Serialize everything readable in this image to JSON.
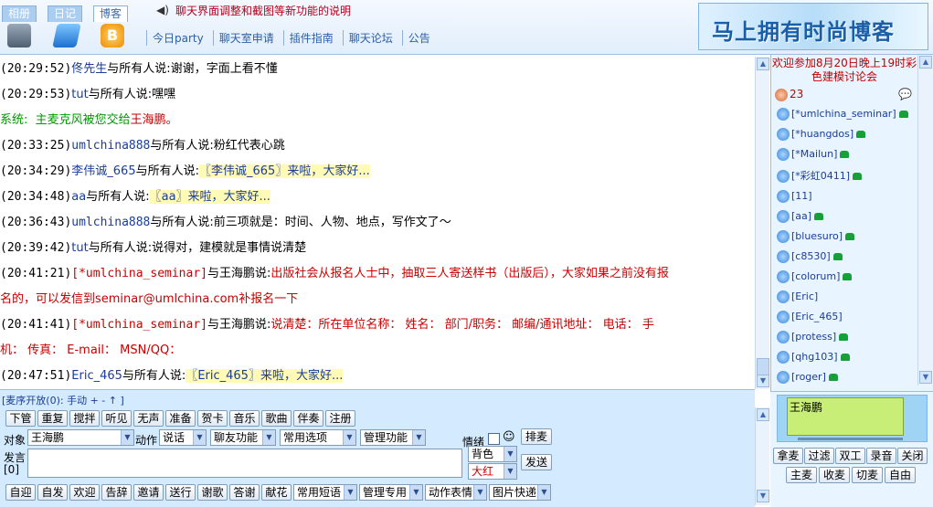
{
  "header": {
    "tabs": [
      "相册",
      "日记",
      "博客"
    ],
    "active_tab": "博客",
    "announcement": "聊天界面调整和截图等新功能的说明",
    "nav": [
      "今日party",
      "聊天室申请",
      "插件指南",
      "聊天论坛",
      "公告"
    ],
    "banner_text": "马上拥有时尚博客"
  },
  "messages": [
    {
      "time": "(20:29:52)",
      "user": "佟先生",
      "to": "与所有人说:",
      "text": "谢谢，字面上看不懂"
    },
    {
      "time": "(20:29:53)",
      "user": "tut",
      "to": "与所有人说:",
      "text": "嘿嘿"
    },
    {
      "system_label": "系统:",
      "system_text": "主麦克风被您交给",
      "system_target": "王海鹏。"
    },
    {
      "time": "(20:33:25)",
      "user": "umlchina888",
      "to": "与所有人说:",
      "text": "粉红代表心跳"
    },
    {
      "time": "(20:34:29)",
      "user": "李伟诚_665",
      "to": "与所有人说:",
      "text": "〖李伟诚_665〗来啦，大家好..."
    },
    {
      "time": "(20:34:48)",
      "user": "aa",
      "to": "与所有人说:",
      "text": "〖aa〗来啦，大家好..."
    },
    {
      "time": "(20:36:43)",
      "user": "umlchina888",
      "to": "与所有人说:",
      "text": "前三项就是：时间、人物、地点，写作文了～"
    },
    {
      "time": "(20:39:42)",
      "user": "tut",
      "to": "与所有人说:",
      "text": "说得对，建模就是事情说清楚"
    },
    {
      "time": "(20:41:21)",
      "user": "[*umlchina_seminar]",
      "to": "与王海鹏说:",
      "text": "出版社会从报名人士中，抽取三人寄送样书（出版后），大家如果之前没有报",
      "text2": "名的，可以发信到seminar@umlchina.com补报名一下"
    },
    {
      "time": "(20:41:41)",
      "user": "[*umlchina_seminar]",
      "to": "与王海鹏说:",
      "text": "说清楚：所在单位名称：  姓名：  部门/职务：  邮编/通讯地址：  电话：  手",
      "text2": "机：  传真：  E-mail：  MSN/QQ："
    },
    {
      "time": "(20:47:51)",
      "user": "Eric_465",
      "to": "与所有人说:",
      "text": "〖Eric_465〗来啦，大家好..."
    }
  ],
  "right_panel": {
    "welcome": "欢迎参加8月20日晚上19时彩色建模讨论会",
    "online_count": "23",
    "users": [
      "[*umlchina_seminar]",
      "[*huangdos]",
      "[*Mailun]",
      "[*彩虹0411]",
      "[11]",
      "[aa]",
      "[bluesuro]",
      "[c8530]",
      "[colorum]",
      "[Eric]",
      "[Eric_465]",
      "[protess]",
      "[qhg103]",
      "[roger]"
    ],
    "mic_user": "王海鹏",
    "mic_buttons_row1": [
      "拿麦",
      "过滤",
      "双工",
      "录音",
      "关闭"
    ],
    "mic_buttons_row2": [
      "主麦",
      "收麦",
      "切麦",
      "自由"
    ]
  },
  "controls": {
    "queue_label": "[麦序开放(0): 手动 + - ↑ ]",
    "row1_buttons": [
      "下管",
      "重复",
      "搅拌",
      "听见",
      "无声",
      "准备",
      "贺卡",
      "音乐",
      "歌曲",
      "伴奏",
      "注册"
    ],
    "target_label": "对象",
    "target_value": "王海鹏",
    "action_label": "动作",
    "action_value": "说话",
    "friend_func": "聊友功能",
    "common_options": "常用选项",
    "manage_func": "管理功能",
    "mood_label": "情绪",
    "mood_icon": "☺",
    "color_value": "背色",
    "size_value": "大红",
    "speak_label": "发言",
    "speak_count": "[0]",
    "arrange_button": "排麦",
    "send_button": "发送",
    "row3_buttons": [
      "自迎",
      "自发",
      "欢迎",
      "告辞",
      "邀请",
      "送行",
      "谢歌",
      "答谢",
      "献花"
    ],
    "row3_dropdowns": [
      "常用短语",
      "管理专用",
      "动作表情",
      "图片快递"
    ]
  }
}
